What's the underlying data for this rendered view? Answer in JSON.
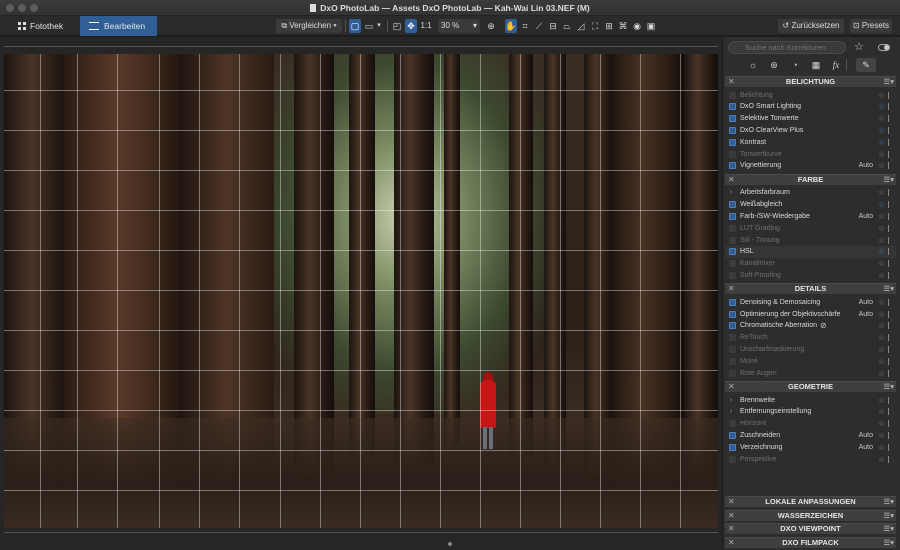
{
  "window": {
    "title": "DxO PhotoLab — Assets DxO PhotoLab — Kah-Wai Lin 03.NEF (M)"
  },
  "toolbar": {
    "tab_library": "Fotothek",
    "tab_edit": "Bearbeiten",
    "compare": "Vergleichen",
    "one_to_one": "1:1",
    "zoom": "30 %",
    "reset": "Zurücksetzen",
    "presets": "Presets"
  },
  "panel": {
    "search_placeholder": "Suche nach Korrekturen",
    "palettes": [
      "light-icon",
      "color-icon",
      "detail-icon",
      "geometry-icon",
      "fx-icon",
      "picker-icon"
    ],
    "sections": [
      {
        "title": "BELICHTUNG",
        "rows": [
          {
            "label": "Belichtung",
            "state": "dim",
            "auto": "",
            "fav": false
          },
          {
            "label": "DxO Smart Lighting",
            "state": "on",
            "auto": "",
            "fav": true
          },
          {
            "label": "Selektive Tonwerte",
            "state": "on",
            "auto": "",
            "fav": false
          },
          {
            "label": "DxO ClearView Plus",
            "state": "on",
            "auto": "",
            "fav": true
          },
          {
            "label": "Kontrast",
            "state": "on",
            "auto": "",
            "fav": true
          },
          {
            "label": "Tonwertkurve",
            "state": "dim",
            "auto": "",
            "fav": false
          },
          {
            "label": "Vignettierung",
            "state": "on",
            "auto": "Auto",
            "fav": false
          }
        ]
      },
      {
        "title": "FARBE",
        "rows": [
          {
            "label": "Arbeitsfarbraum",
            "state": "chev",
            "auto": "",
            "fav": false
          },
          {
            "label": "Weißabgleich",
            "state": "on",
            "auto": "",
            "fav": true
          },
          {
            "label": "Farb-/SW-Wiedergabe",
            "state": "on",
            "auto": "Auto",
            "fav": false
          },
          {
            "label": "LUT Grading",
            "state": "dim",
            "auto": "",
            "fav": false
          },
          {
            "label": "Stil - Tönung",
            "state": "dim",
            "auto": "",
            "fav": false
          },
          {
            "label": "HSL",
            "state": "on",
            "auto": "",
            "fav": true
          },
          {
            "label": "Kanalmixer",
            "state": "dim",
            "auto": "",
            "fav": false
          },
          {
            "label": "Soft-Proofing",
            "state": "dim",
            "auto": "",
            "fav": false
          }
        ]
      },
      {
        "title": "DETAILS",
        "rows": [
          {
            "label": "Denoising & Demosaicing",
            "state": "on",
            "auto": "Auto",
            "fav": false
          },
          {
            "label": "Optimierung der Objektivschärfe",
            "state": "on",
            "auto": "Auto",
            "fav": false
          },
          {
            "label": "Chromatische Aberration",
            "state": "on",
            "auto": "",
            "fav": false
          },
          {
            "label": "ReTouch",
            "state": "dim",
            "auto": "",
            "fav": false
          },
          {
            "label": "Unscharfmaskierung",
            "state": "dim",
            "auto": "",
            "fav": false
          },
          {
            "label": "Moiré",
            "state": "dim",
            "auto": "",
            "fav": false
          },
          {
            "label": "Rote Augen",
            "state": "dim",
            "auto": "",
            "fav": false
          }
        ]
      },
      {
        "title": "GEOMETRIE",
        "rows": [
          {
            "label": "Brennweite",
            "state": "chev",
            "auto": "",
            "fav": false
          },
          {
            "label": "Entfernungseinstellung",
            "state": "chev",
            "auto": "",
            "fav": false
          },
          {
            "label": "Horizont",
            "state": "dim",
            "auto": "",
            "fav": false
          },
          {
            "label": "Zuschneiden",
            "state": "on",
            "auto": "Auto",
            "fav": false
          },
          {
            "label": "Verzeichnung",
            "state": "on",
            "auto": "Auto",
            "fav": false
          },
          {
            "label": "Perspektive",
            "state": "dim",
            "auto": "",
            "fav": false
          }
        ]
      }
    ],
    "collapsed_sections": [
      "LOKALE ANPASSUNGEN",
      "WASSERZEICHEN",
      "DXO VIEWPOINT",
      "DXO FILMPACK"
    ]
  }
}
